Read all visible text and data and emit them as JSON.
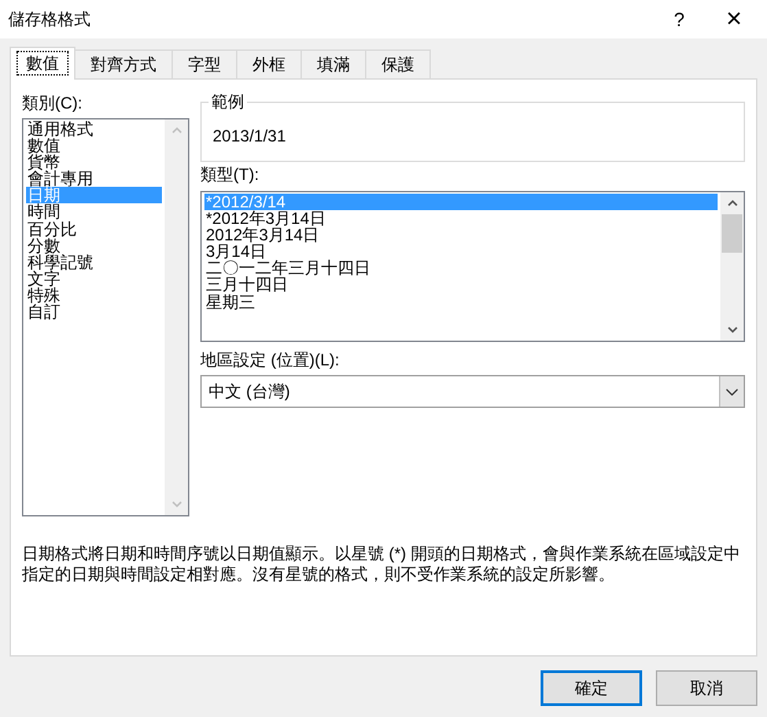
{
  "window": {
    "title": "儲存格格式",
    "help": "?",
    "close": "×"
  },
  "tabs": [
    {
      "label": "數值",
      "selected": true
    },
    {
      "label": "對齊方式",
      "selected": false
    },
    {
      "label": "字型",
      "selected": false
    },
    {
      "label": "外框",
      "selected": false
    },
    {
      "label": "填滿",
      "selected": false
    },
    {
      "label": "保護",
      "selected": false
    }
  ],
  "category": {
    "label": "類別(C):",
    "items": [
      {
        "label": "通用格式",
        "selected": false
      },
      {
        "label": "數值",
        "selected": false
      },
      {
        "label": "貨幣",
        "selected": false
      },
      {
        "label": "會計專用",
        "selected": false
      },
      {
        "label": "日期",
        "selected": true
      },
      {
        "label": "時間",
        "selected": false
      },
      {
        "label": "百分比",
        "selected": false
      },
      {
        "label": "分數",
        "selected": false
      },
      {
        "label": "科學記號",
        "selected": false
      },
      {
        "label": "文字",
        "selected": false
      },
      {
        "label": "特殊",
        "selected": false
      },
      {
        "label": "自訂",
        "selected": false
      }
    ]
  },
  "sample": {
    "label": "範例",
    "value": "2013/1/31"
  },
  "type": {
    "label": "類型(T):",
    "items": [
      {
        "label": "*2012/3/14",
        "selected": true
      },
      {
        "label": "*2012年3月14日",
        "selected": false
      },
      {
        "label": "2012年3月14日",
        "selected": false
      },
      {
        "label": "3月14日",
        "selected": false
      },
      {
        "label": "二〇一二年三月十四日",
        "selected": false
      },
      {
        "label": "三月十四日",
        "selected": false
      },
      {
        "label": "星期三",
        "selected": false
      }
    ]
  },
  "locale": {
    "label": "地區設定 (位置)(L):",
    "value": "中文 (台灣)"
  },
  "description": "日期格式將日期和時間序號以日期值顯示。以星號 (*) 開頭的日期格式，會與作業系統在區域設定中指定的日期與時間設定相對應。沒有星號的格式，則不受作業系統的設定所影響。",
  "buttons": [
    {
      "label": "確定",
      "default": true
    },
    {
      "label": "取消",
      "default": false
    }
  ]
}
